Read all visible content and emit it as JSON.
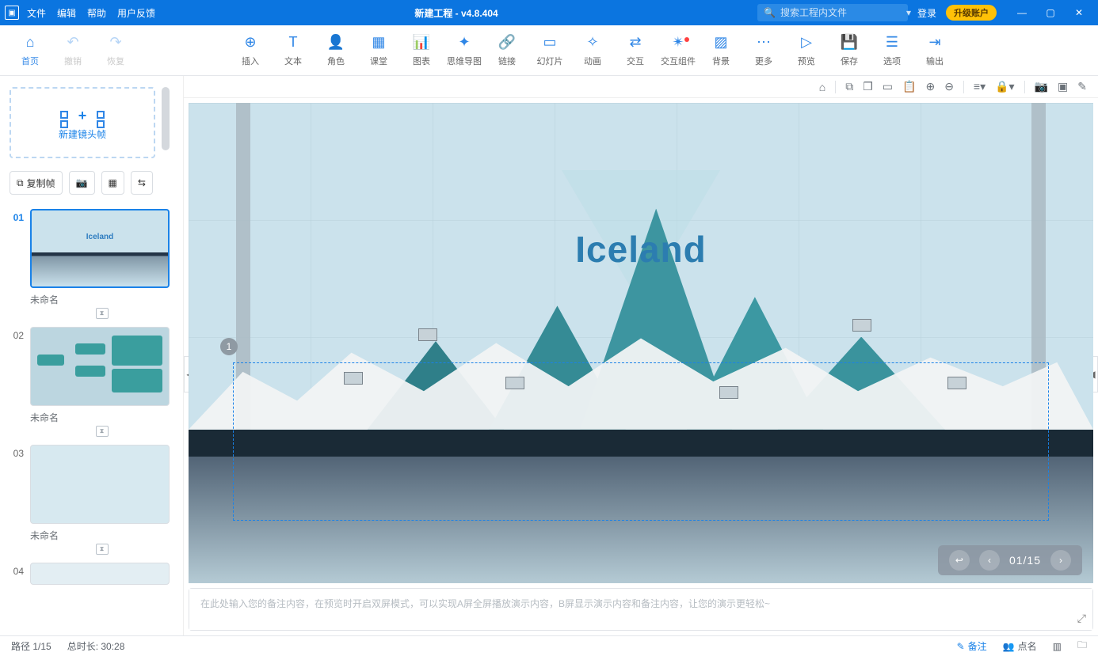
{
  "title": "新建工程 - v4.8.404",
  "menu": {
    "file": "文件",
    "edit": "编辑",
    "help": "帮助",
    "feedback": "用户反馈"
  },
  "search": {
    "placeholder": "搜索工程内文件"
  },
  "login": "登录",
  "upgrade": "升级账户",
  "toolbar": {
    "home": "首页",
    "undo": "撤销",
    "redo": "恢复",
    "insert": "插入",
    "text": "文本",
    "role": "角色",
    "class": "课堂",
    "chart": "图表",
    "mindmap": "思维导图",
    "link": "链接",
    "slide": "幻灯片",
    "animation": "动画",
    "interact": "交互",
    "widget": "交互组件",
    "background": "背景",
    "more": "更多",
    "preview": "预览",
    "save": "保存",
    "options": "选项",
    "export": "输出"
  },
  "sidebar": {
    "new_frame": "新建镜头帧",
    "copy_frame": "复制帧",
    "slides": [
      {
        "num": "01",
        "title": "未命名",
        "canvas_title": "Iceland"
      },
      {
        "num": "02",
        "title": "未命名"
      },
      {
        "num": "03",
        "title": "未命名"
      },
      {
        "num": "04",
        "title": ""
      }
    ]
  },
  "slide_marker": "1",
  "canvas": {
    "title": "Iceland",
    "nav": {
      "current": "01",
      "total": "15",
      "label": "01/15"
    }
  },
  "notes_placeholder": "在此处输入您的备注内容，在预览时开启双屏模式，可以实现A屏全屏播放演示内容，B屏显示演示内容和备注内容，让您的演示更轻松~",
  "status": {
    "path": "路径 1/15",
    "duration": "总时长: 30:28",
    "remark": "备注",
    "roll": "点名"
  }
}
